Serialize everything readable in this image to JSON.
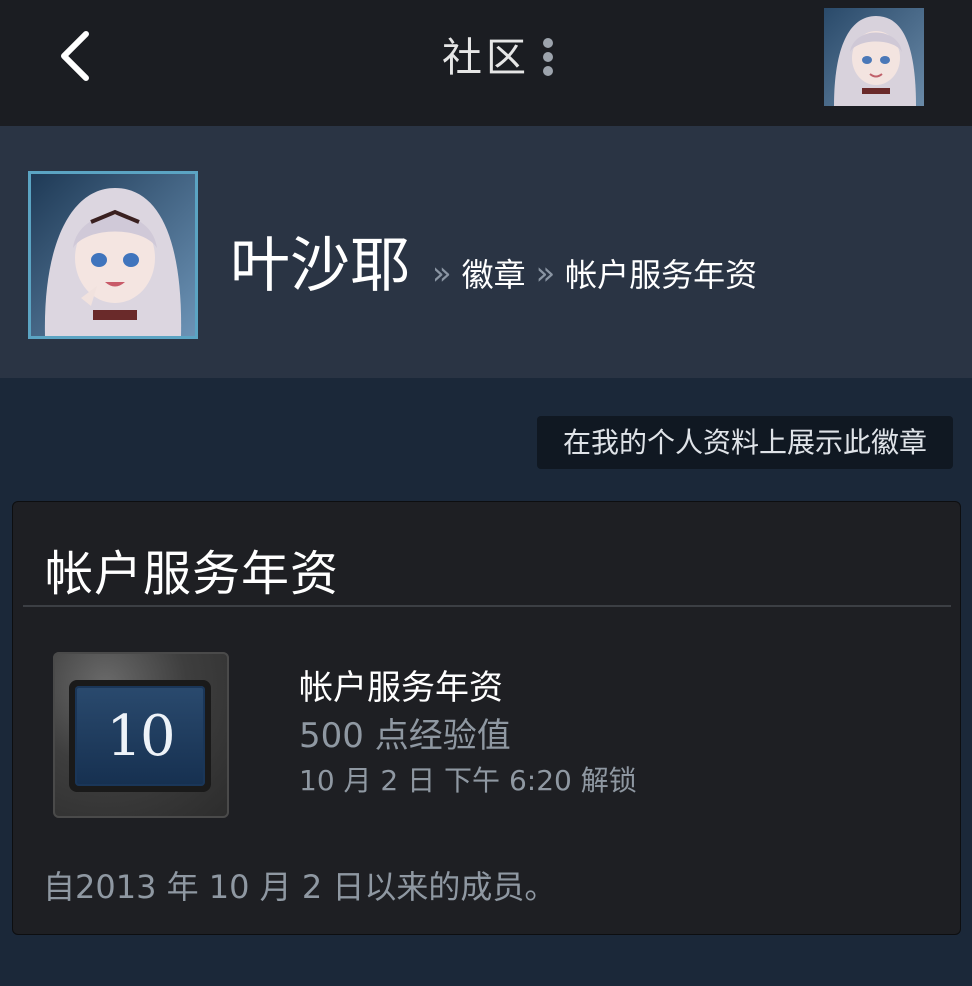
{
  "topbar": {
    "title": "社区",
    "back_icon": "chevron-left-icon",
    "menu_icon": "kebab-menu-icon"
  },
  "profile": {
    "persona_name": "叶沙耶",
    "separator": "»",
    "crumb_badges": "徽章",
    "crumb_current": "帐户服务年资"
  },
  "actions": {
    "showcase_label": "在我的个人资料上展示此徽章"
  },
  "badge": {
    "section_title": "帐户服务年资",
    "icon_number": "10",
    "name": "帐户服务年资",
    "xp": "500 点经验值",
    "unlocked": "10 月 2 日 下午 6:20 解锁",
    "member_since": "自2013 年 10 月 2 日以来的成员。"
  },
  "colors": {
    "topbar_bg": "#1b1d22",
    "header_bg": "#2a3444",
    "page_bg": "#1b2839",
    "card_bg": "#1e1f23",
    "muted_text": "#8f98a2",
    "avatar_border": "#5ba4c3"
  }
}
